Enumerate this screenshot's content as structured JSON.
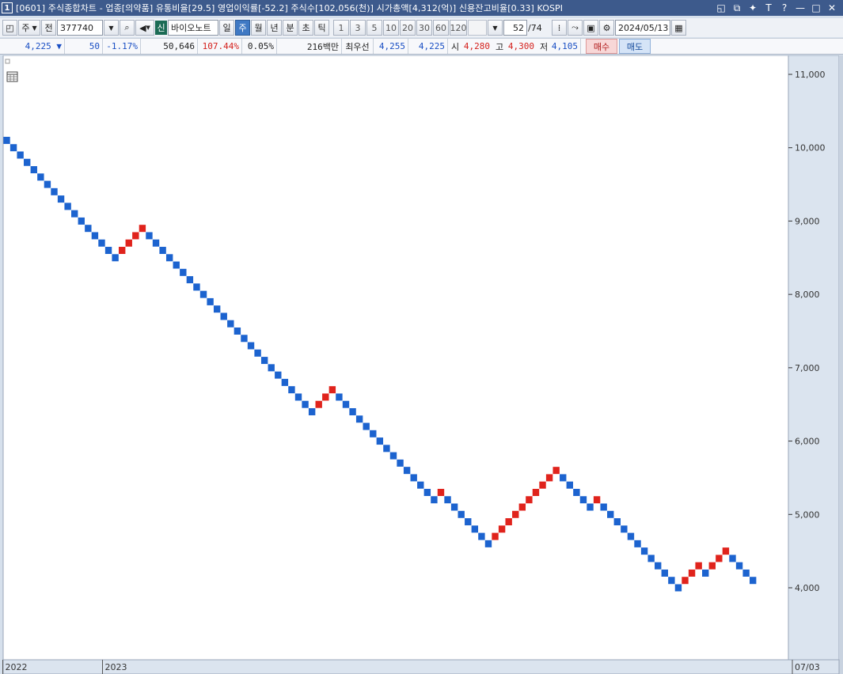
{
  "window": {
    "index": "1",
    "title": "[0601] 주식종합차트 - 업종[의약품] 유통비율[29.5] 영업이익률[-52.2] 주식수[102,056(천)] 시가총액[4,312(억)] 신용잔고비율[0.33] KOSPI",
    "icons": [
      "restore-icon",
      "cascade-icon",
      "pin-icon",
      "text-icon",
      "help-icon",
      "minimize-icon",
      "maximize-icon",
      "close-icon"
    ]
  },
  "toolbar": {
    "mode_label": "주",
    "prev_label": "전",
    "code": "377740",
    "sin_badge": "신",
    "stock_name": "바이오노트",
    "periods": [
      "일",
      "주",
      "월",
      "년",
      "분",
      "초",
      "틱"
    ],
    "active_period": "주",
    "intervals": [
      "1",
      "3",
      "5",
      "10",
      "20",
      "30",
      "60",
      "120"
    ],
    "count": "52",
    "count_total": "/74",
    "date": "2024/05/13"
  },
  "quote": {
    "price": "4,225",
    "arrow": "▼",
    "change": "50",
    "change_pct": "-1.17%",
    "volume": "50,646",
    "vol_ratio": "107.44%",
    "turnover": "0.05%",
    "amount": "216백만",
    "best_label": "최우선",
    "ask": "4,255",
    "bid": "4,225",
    "open_label": "시",
    "open": "4,280",
    "high_label": "고",
    "high": "4,300",
    "low_label": "저",
    "low": "4,105",
    "buy_label": "매수",
    "sell_label": "매도"
  },
  "colors": {
    "up": "#e0231c",
    "down": "#1c63cf",
    "title_bg": "#3d5a8c",
    "chart_bg": "#ffffff",
    "axis_bg": "#dbe4ef"
  },
  "chart_data": {
    "type": "scatter",
    "chart_style": "three-line-break / point-and-figure style columns of boxes",
    "ylim": [
      3000,
      11200
    ],
    "yticks": [
      4000,
      5000,
      6000,
      7000,
      8000,
      9000,
      10000,
      11000
    ],
    "ytick_labels": [
      "4,000",
      "5,000",
      "6,000",
      "7,000",
      "8,000",
      "9,000",
      "10,000",
      "11,000"
    ],
    "x_labels": [
      {
        "label": "2022",
        "index": 0
      },
      {
        "label": "2023",
        "index": 14.7
      },
      {
        "label": "07/03",
        "index": 112
      }
    ],
    "grid": false,
    "series": [
      {
        "boxes": [
          [
            0,
            10100,
            "down"
          ],
          [
            1,
            10000,
            "down"
          ],
          [
            2,
            9900,
            "down"
          ],
          [
            3,
            9800,
            "down"
          ],
          [
            4,
            9700,
            "down"
          ],
          [
            5,
            9600,
            "down"
          ],
          [
            6,
            9500,
            "down"
          ],
          [
            7,
            9400,
            "down"
          ],
          [
            8,
            9300,
            "down"
          ],
          [
            9,
            9200,
            "down"
          ],
          [
            10,
            9100,
            "down"
          ],
          [
            11,
            9000,
            "down"
          ],
          [
            12,
            8900,
            "down"
          ],
          [
            13,
            8800,
            "down"
          ],
          [
            14,
            8700,
            "down"
          ],
          [
            15,
            8600,
            "down"
          ],
          [
            16,
            8500,
            "down"
          ],
          [
            17,
            8600,
            "up"
          ],
          [
            18,
            8700,
            "up"
          ],
          [
            19,
            8800,
            "up"
          ],
          [
            20,
            8900,
            "up"
          ],
          [
            21,
            8800,
            "down"
          ],
          [
            22,
            8700,
            "down"
          ],
          [
            23,
            8600,
            "down"
          ],
          [
            24,
            8500,
            "down"
          ],
          [
            25,
            8400,
            "down"
          ],
          [
            26,
            8300,
            "down"
          ],
          [
            27,
            8200,
            "down"
          ],
          [
            28,
            8100,
            "down"
          ],
          [
            29,
            8000,
            "down"
          ],
          [
            30,
            7900,
            "down"
          ],
          [
            31,
            7800,
            "down"
          ],
          [
            32,
            7700,
            "down"
          ],
          [
            33,
            7600,
            "down"
          ],
          [
            34,
            7500,
            "down"
          ],
          [
            35,
            7400,
            "down"
          ],
          [
            36,
            7300,
            "down"
          ],
          [
            37,
            7200,
            "down"
          ],
          [
            38,
            7100,
            "down"
          ],
          [
            39,
            7000,
            "down"
          ],
          [
            40,
            6900,
            "down"
          ],
          [
            41,
            6800,
            "down"
          ],
          [
            42,
            6700,
            "down"
          ],
          [
            43,
            6600,
            "down"
          ],
          [
            44,
            6500,
            "down"
          ],
          [
            45,
            6400,
            "down"
          ],
          [
            46,
            6500,
            "up"
          ],
          [
            47,
            6600,
            "up"
          ],
          [
            48,
            6700,
            "up"
          ],
          [
            49,
            6600,
            "down"
          ],
          [
            50,
            6500,
            "down"
          ],
          [
            51,
            6400,
            "down"
          ],
          [
            52,
            6300,
            "down"
          ],
          [
            53,
            6200,
            "down"
          ],
          [
            54,
            6100,
            "down"
          ],
          [
            55,
            6000,
            "down"
          ],
          [
            56,
            5900,
            "down"
          ],
          [
            57,
            5800,
            "down"
          ],
          [
            58,
            5700,
            "down"
          ],
          [
            59,
            5600,
            "down"
          ],
          [
            60,
            5500,
            "down"
          ],
          [
            61,
            5400,
            "down"
          ],
          [
            62,
            5300,
            "down"
          ],
          [
            63,
            5200,
            "down"
          ],
          [
            64,
            5300,
            "up"
          ],
          [
            65,
            5200,
            "down"
          ],
          [
            66,
            5100,
            "down"
          ],
          [
            67,
            5000,
            "down"
          ],
          [
            68,
            4900,
            "down"
          ],
          [
            69,
            4800,
            "down"
          ],
          [
            70,
            4700,
            "down"
          ],
          [
            71,
            4600,
            "down"
          ],
          [
            72,
            4700,
            "up"
          ],
          [
            73,
            4800,
            "up"
          ],
          [
            74,
            4900,
            "up"
          ],
          [
            75,
            5000,
            "up"
          ],
          [
            76,
            5100,
            "up"
          ],
          [
            77,
            5200,
            "up"
          ],
          [
            78,
            5300,
            "up"
          ],
          [
            79,
            5400,
            "up"
          ],
          [
            80,
            5500,
            "up"
          ],
          [
            81,
            5600,
            "up"
          ],
          [
            82,
            5500,
            "down"
          ],
          [
            83,
            5400,
            "down"
          ],
          [
            84,
            5300,
            "down"
          ],
          [
            85,
            5200,
            "down"
          ],
          [
            86,
            5100,
            "down"
          ],
          [
            87,
            5200,
            "up"
          ],
          [
            88,
            5100,
            "down"
          ],
          [
            89,
            5000,
            "down"
          ],
          [
            90,
            4900,
            "down"
          ],
          [
            91,
            4800,
            "down"
          ],
          [
            92,
            4700,
            "down"
          ],
          [
            93,
            4600,
            "down"
          ],
          [
            94,
            4500,
            "down"
          ],
          [
            95,
            4400,
            "down"
          ],
          [
            96,
            4300,
            "down"
          ],
          [
            97,
            4200,
            "down"
          ],
          [
            98,
            4100,
            "down"
          ],
          [
            99,
            4000,
            "down"
          ],
          [
            100,
            4100,
            "up"
          ],
          [
            101,
            4200,
            "up"
          ],
          [
            102,
            4300,
            "up"
          ],
          [
            103,
            4200,
            "down"
          ],
          [
            104,
            4300,
            "up"
          ],
          [
            105,
            4400,
            "up"
          ],
          [
            106,
            4500,
            "up"
          ],
          [
            107,
            4400,
            "down"
          ],
          [
            108,
            4300,
            "down"
          ],
          [
            109,
            4200,
            "down"
          ],
          [
            110,
            4100,
            "down"
          ]
        ]
      }
    ]
  }
}
